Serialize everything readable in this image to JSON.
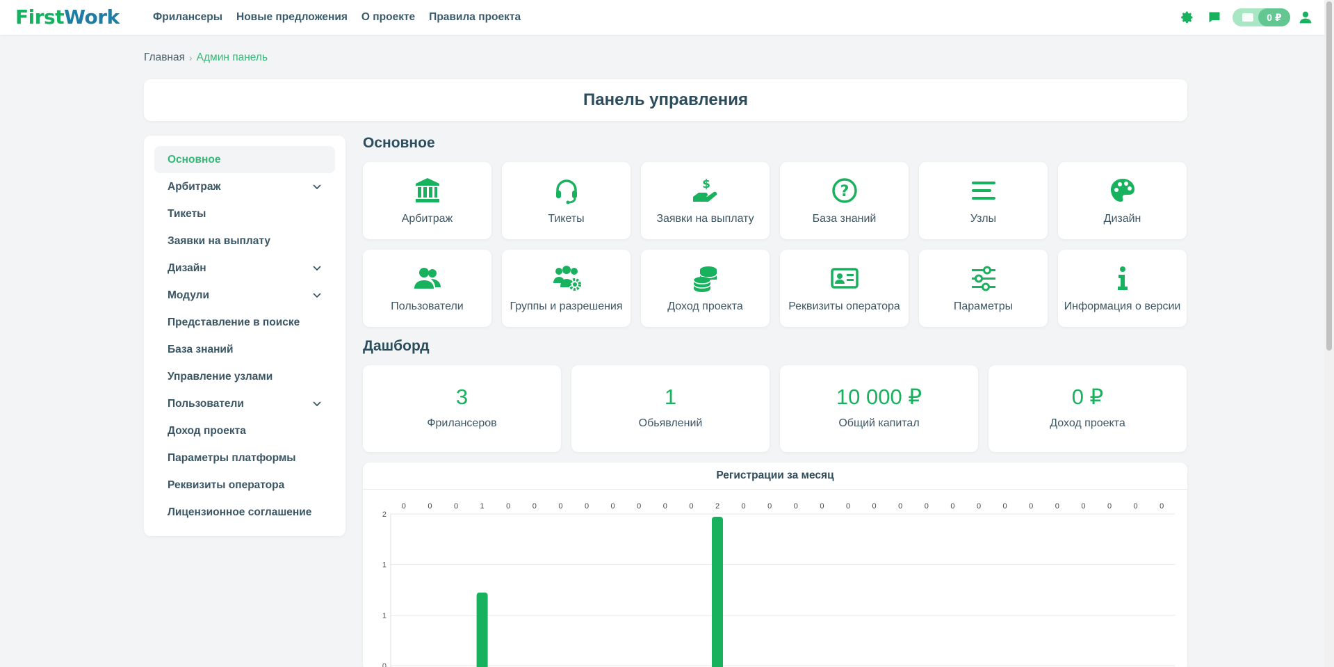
{
  "header": {
    "logo_part1": "First",
    "logo_part2": "Work",
    "nav": [
      "Фрилансеры",
      "Новые предложения",
      "О проекте",
      "Правила проекта"
    ],
    "wallet_balance": "0 ₽",
    "icons": [
      "gear-icon",
      "chat-icon",
      "wallet-icon",
      "user-icon"
    ]
  },
  "breadcrumb": {
    "home": "Главная",
    "separator": "›",
    "current": "Админ панель"
  },
  "page_title": "Панель управления",
  "sidebar": {
    "items": [
      {
        "label": "Основное",
        "active": true,
        "has_children": false
      },
      {
        "label": "Арбитраж",
        "active": false,
        "has_children": true
      },
      {
        "label": "Тикеты",
        "active": false,
        "has_children": false
      },
      {
        "label": "Заявки на выплату",
        "active": false,
        "has_children": false
      },
      {
        "label": "Дизайн",
        "active": false,
        "has_children": true
      },
      {
        "label": "Модули",
        "active": false,
        "has_children": true
      },
      {
        "label": "Представление в поиске",
        "active": false,
        "has_children": false
      },
      {
        "label": "База знаний",
        "active": false,
        "has_children": false
      },
      {
        "label": "Управление узлами",
        "active": false,
        "has_children": false
      },
      {
        "label": "Пользователи",
        "active": false,
        "has_children": true
      },
      {
        "label": "Доход проекта",
        "active": false,
        "has_children": false
      },
      {
        "label": "Параметры платформы",
        "active": false,
        "has_children": false
      },
      {
        "label": "Реквизиты оператора",
        "active": false,
        "has_children": false
      },
      {
        "label": "Лицензионное соглашение",
        "active": false,
        "has_children": false
      }
    ]
  },
  "main_section_title": "Основное",
  "tiles": [
    {
      "label": "Арбитраж",
      "icon": "bank-icon"
    },
    {
      "label": "Тикеты",
      "icon": "headset-icon"
    },
    {
      "label": "Заявки на выплату",
      "icon": "hand-dollar-icon"
    },
    {
      "label": "База знаний",
      "icon": "question-circle-icon"
    },
    {
      "label": "Узлы",
      "icon": "lines-icon"
    },
    {
      "label": "Дизайн",
      "icon": "palette-icon"
    },
    {
      "label": "Пользователи",
      "icon": "users-icon"
    },
    {
      "label": "Группы и разрешения",
      "icon": "users-gear-icon"
    },
    {
      "label": "Доход проекта",
      "icon": "coins-icon"
    },
    {
      "label": "Реквизиты оператора",
      "icon": "id-card-icon"
    },
    {
      "label": "Параметры",
      "icon": "sliders-icon"
    },
    {
      "label": "Информация о версии",
      "icon": "info-icon"
    }
  ],
  "dashboard_title": "Дашборд",
  "stats": [
    {
      "value": "3",
      "caption": "Фрилансеров"
    },
    {
      "value": "1",
      "caption": "Обьявлений"
    },
    {
      "value": "10 000 ₽",
      "caption": "Общий капитал"
    },
    {
      "value": "0 ₽",
      "caption": "Доход проекта"
    }
  ],
  "colors": {
    "accent": "#18b25f",
    "text": "#2c4d5e",
    "background": "#f2f4f5"
  },
  "chart_data": {
    "type": "bar",
    "title": "Регистрации за месяц",
    "values": [
      0,
      0,
      0,
      1,
      0,
      0,
      0,
      0,
      0,
      0,
      0,
      0,
      2,
      0,
      0,
      0,
      0,
      0,
      0,
      0,
      0,
      0,
      0,
      0,
      0,
      0,
      0,
      0,
      0,
      0
    ],
    "y_tick_labels": [
      "2",
      "1",
      "1",
      "0"
    ],
    "ylim": [
      0,
      2
    ],
    "grid": true,
    "bar_color": "#18b25f"
  }
}
